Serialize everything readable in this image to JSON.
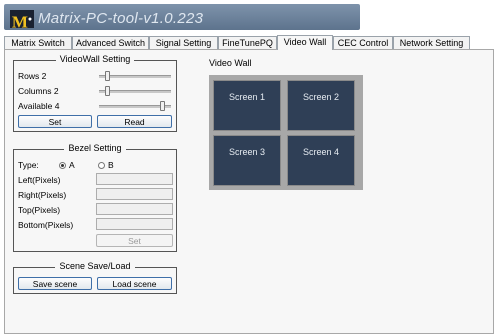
{
  "app": {
    "title": "Matrix-PC-tool-v1.0.223",
    "logo_text": "M"
  },
  "tabs": [
    {
      "label": "Matrix Switch"
    },
    {
      "label": "Advanced Switch"
    },
    {
      "label": "Signal Setting"
    },
    {
      "label": "FineTunePQ"
    },
    {
      "label": "Video Wall",
      "active": true
    },
    {
      "label": "CEC Control"
    },
    {
      "label": "Network Setting"
    }
  ],
  "videowall_setting": {
    "title": "VideoWall Setting",
    "rows_label": "Rows 2",
    "columns_label": "Columns 2",
    "available_label": "Available 4",
    "rows_value": 2,
    "columns_value": 2,
    "available_value": 4,
    "set_label": "Set",
    "read_label": "Read"
  },
  "bezel_setting": {
    "title": "Bezel Setting",
    "type_label": "Type:",
    "type_a": "A",
    "type_b": "B",
    "selected_type": "A",
    "left_label": "Left(Pixels)",
    "right_label": "Right(Pixels)",
    "top_label": "Top(Pixels)",
    "bottom_label": "Bottom(Pixels)",
    "set_label": "Set"
  },
  "scene": {
    "title": "Scene Save/Load",
    "save_label": "Save scene",
    "load_label": "Load scene"
  },
  "wall": {
    "title": "Video Wall",
    "screens": [
      "Screen 1",
      "Screen 2",
      "Screen 3",
      "Screen 4"
    ]
  },
  "colors": {
    "screen_bg": "#2f3f56",
    "button_border": "#3f6fa8"
  }
}
